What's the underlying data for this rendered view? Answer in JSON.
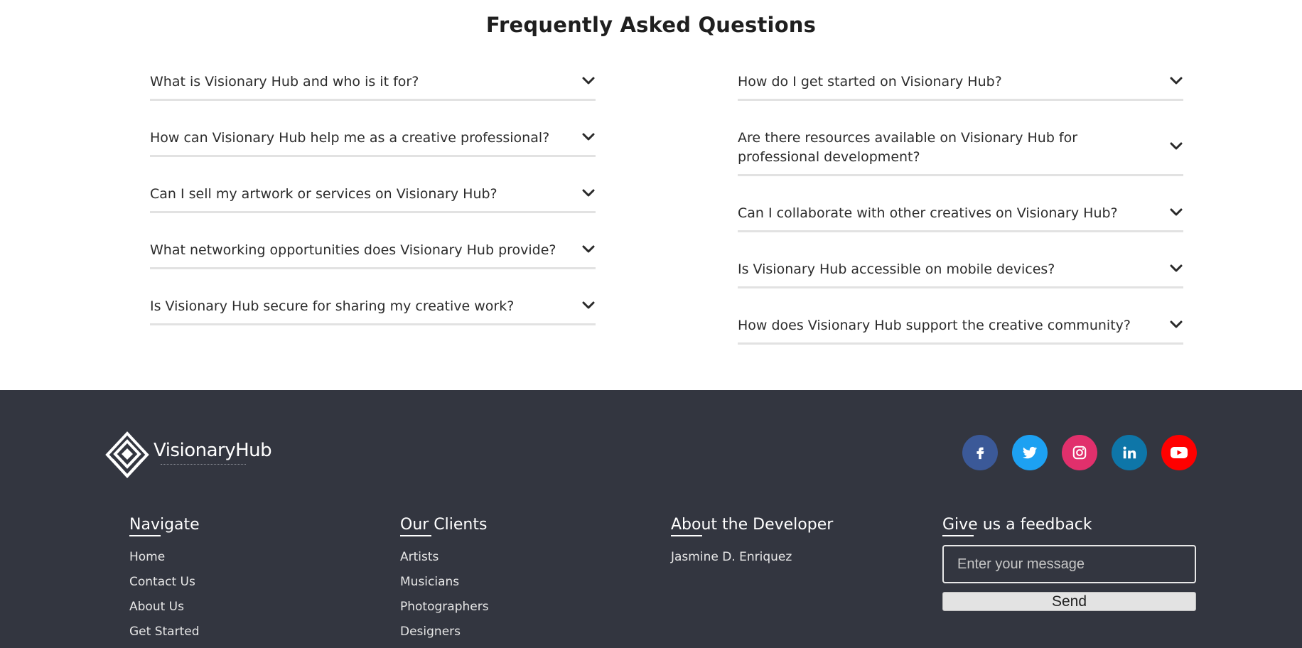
{
  "faq": {
    "title": "Frequently Asked Questions",
    "left": [
      "What is Visionary Hub and who is it for?",
      "How can Visionary Hub help me as a creative professional?",
      "Can I sell my artwork or services on Visionary Hub?",
      "What networking opportunities does Visionary Hub provide?",
      "Is Visionary Hub secure for sharing my creative work?"
    ],
    "right": [
      "How do I get started on Visionary Hub?",
      "Are there resources available on Visionary Hub for professional development?",
      "Can I collaborate with other creatives on Visionary Hub?",
      "Is Visionary Hub accessible on mobile devices?",
      "How does Visionary Hub support the creative community?"
    ]
  },
  "footer": {
    "logo_text": "VisionaryHub",
    "socials": [
      {
        "icon": "facebook-icon",
        "color": "#3b5998"
      },
      {
        "icon": "twitter-icon",
        "color": "#1da1f2"
      },
      {
        "icon": "instagram-icon",
        "color": "#e1306c"
      },
      {
        "icon": "linkedin-icon",
        "color": "#0e76a8"
      },
      {
        "icon": "youtube-icon",
        "color": "#ff0000"
      }
    ],
    "navigate": {
      "heading": "Navigate",
      "items": [
        "Home",
        "Contact Us",
        "About Us",
        "Get Started"
      ]
    },
    "clients": {
      "heading": "Our Clients",
      "items": [
        "Artists",
        "Musicians",
        "Photographers",
        "Designers"
      ]
    },
    "developer": {
      "heading": "About the Developer",
      "items": [
        "Jasmine D. Enriquez"
      ]
    },
    "feedback": {
      "heading": "Give us a feedback",
      "placeholder": "Enter your message",
      "button": "Send"
    }
  },
  "colors": {
    "footer_bg": "#333640",
    "divider": "#e2e2e2"
  }
}
